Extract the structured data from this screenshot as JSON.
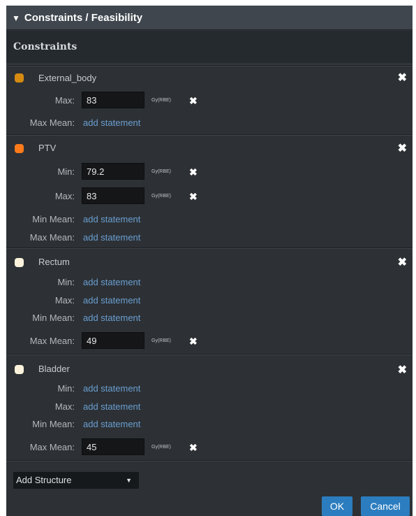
{
  "header": {
    "title": "Constraints / Feasibility",
    "collapse_icon": "triangle-down-icon"
  },
  "subheader": {
    "title": "Constraints"
  },
  "link_text": "add statement",
  "structures": [
    {
      "name": "External_body",
      "color": "#d68a12",
      "rows": {
        "max": {
          "label": "Max:",
          "value": "83",
          "unit": "Gy(RBE)"
        },
        "max_mean": {
          "label": "Max Mean:",
          "link": "add statement"
        }
      }
    },
    {
      "name": "PTV",
      "color": "#ff7a1a",
      "rows": {
        "min": {
          "label": "Min:",
          "value": "79.2",
          "unit": "Gy(RBE)"
        },
        "max": {
          "label": "Max:",
          "value": "83",
          "unit": "Gy(RBE)"
        },
        "min_mean": {
          "label": "Min Mean:",
          "link": "add statement"
        },
        "max_mean": {
          "label": "Max Mean:",
          "link": "add statement"
        }
      }
    },
    {
      "name": "Rectum",
      "color": "#fdf3dc",
      "rows": {
        "min": {
          "label": "Min:",
          "link": "add statement"
        },
        "max": {
          "label": "Max:",
          "link": "add statement"
        },
        "min_mean": {
          "label": "Min Mean:",
          "link": "add statement"
        },
        "max_mean": {
          "label": "Max Mean:",
          "value": "49",
          "unit": "Gy(RBE)"
        }
      }
    },
    {
      "name": "Bladder",
      "color": "#fdf3dc",
      "rows": {
        "min": {
          "label": "Min:",
          "link": "add statement"
        },
        "max": {
          "label": "Max:",
          "link": "add statement"
        },
        "min_mean": {
          "label": "Min Mean:",
          "link": "add statement"
        },
        "max_mean": {
          "label": "Max Mean:",
          "value": "45",
          "unit": "Gy(RBE)"
        }
      }
    }
  ],
  "footer": {
    "add_structure_label": "Add Structure",
    "ok_label": "OK",
    "cancel_label": "Cancel"
  },
  "colors": {
    "accent": "#2c7dbf",
    "link": "#6a9ed1",
    "panel_bg": "#2d3135"
  }
}
